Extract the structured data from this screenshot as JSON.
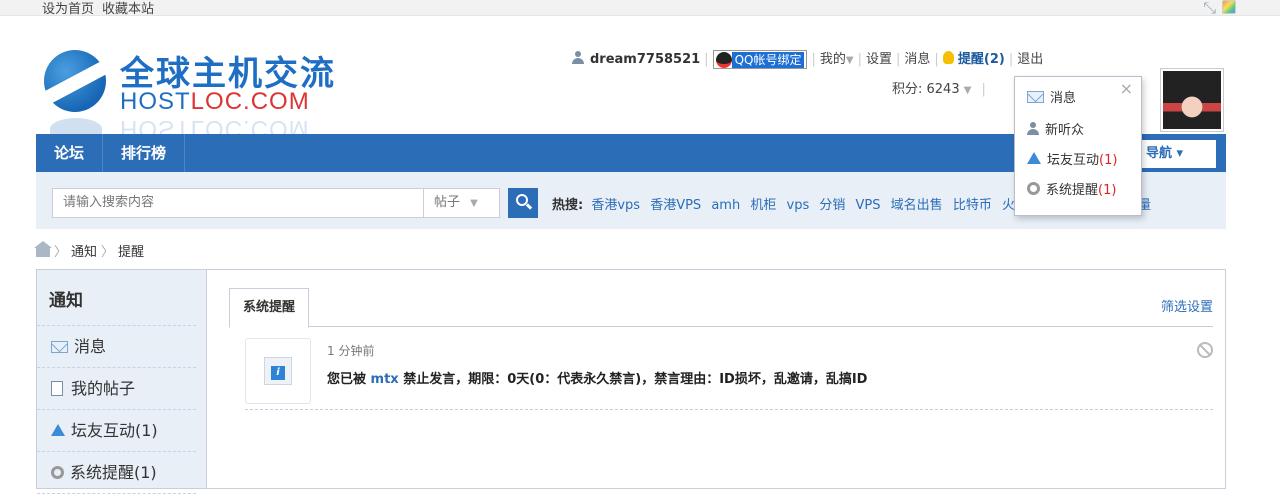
{
  "topbar": {
    "set_home": "设为首页",
    "bookmark": "收藏本站"
  },
  "logo": {
    "cn": "全球主机交流",
    "en_part1": "HOST",
    "en_part2": "LOC.COM",
    "en_full": "HOSTLOC.COM"
  },
  "user": {
    "username": "dream7758521",
    "qq_bind": "QQ帐号绑定",
    "mine": "我的",
    "settings": "设置",
    "messages": "消息",
    "remind": "提醒(2)",
    "logout": "退出",
    "credits": "积分: 6243"
  },
  "nav": {
    "items": [
      "论坛",
      "排行榜"
    ],
    "quick_nav": "导航"
  },
  "search": {
    "placeholder": "请输入搜索内容",
    "type": "帖子",
    "hot_label": "热搜:",
    "hot_terms": [
      "香港vps",
      "香港VPS",
      "amh",
      "机柜",
      "vps",
      "分销",
      "VPS",
      "域名出售",
      "比特币",
      "火",
      "流量"
    ]
  },
  "breadcrumb": {
    "items": [
      "通知",
      "提醒"
    ]
  },
  "sidebar": {
    "title": "通知",
    "items": [
      {
        "label": "消息"
      },
      {
        "label": "我的帖子"
      },
      {
        "label": "坛友互动(1)"
      },
      {
        "label": "系统提醒(1)"
      }
    ]
  },
  "content": {
    "tab": "系统提醒",
    "filter": "筛选设置",
    "notice": {
      "time": "1 分钟前",
      "prefix": "您已被",
      "user": "mtx",
      "text": "禁止发言，期限：0天(0：代表永久禁言)，禁言理由：ID损坏，乱邀请，乱搞ID"
    }
  },
  "dropdown": {
    "close": "×",
    "items": [
      {
        "label": "消息",
        "count": ""
      },
      {
        "label": "新听众",
        "count": ""
      },
      {
        "label": "坛友互动",
        "count": "(1)"
      },
      {
        "label": "系统提醒",
        "count": "(1)"
      }
    ]
  }
}
